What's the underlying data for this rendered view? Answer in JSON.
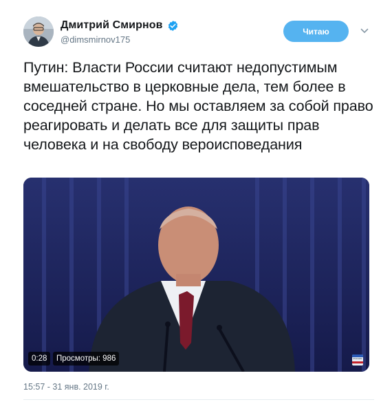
{
  "author": {
    "name": "Дмитрий Смирнов",
    "handle": "@dimsmirnov175",
    "verified": true,
    "avatar_icon": "user-avatar"
  },
  "actions": {
    "follow_label": "Читаю",
    "menu_icon": "chevron-down-icon"
  },
  "tweet": {
    "text": "Путин: Власти России считают недопустимым вмешательство в церковные дела, тем более в соседней стране. Но мы оставляем за собой право реагировать и делать все для защиты прав человека и на свободу вероисповедания",
    "timestamp": "15:57 - 31 янв. 2019 г."
  },
  "video": {
    "duration": "0:28",
    "views": "Просмотры: 986",
    "channel_logo": "РОССИЯ"
  },
  "colors": {
    "accent": "#1da1f2",
    "follow_button": "#55b3f0",
    "secondary_text": "#657786"
  }
}
